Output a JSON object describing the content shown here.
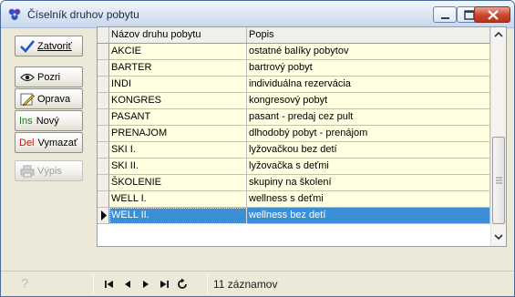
{
  "window": {
    "title": "Číselník druhov pobytu"
  },
  "buttons": {
    "close_label": "Zatvoriť",
    "view_label": "Pozri",
    "edit_label": "Oprava",
    "new_prefix": "Ins",
    "new_label": "Nový",
    "delete_prefix": "Del",
    "delete_label": "Vymazať",
    "print_label": "Výpis"
  },
  "table": {
    "columns": [
      "Názov druhu pobytu",
      "Popis"
    ],
    "rows": [
      {
        "name": "AKCIE",
        "desc": "ostatné balíky pobytov"
      },
      {
        "name": "BARTER",
        "desc": "bartrový pobyt"
      },
      {
        "name": "INDI",
        "desc": "individuálna rezervácia"
      },
      {
        "name": "KONGRES",
        "desc": "kongresový pobyt"
      },
      {
        "name": "PASANT",
        "desc": "pasant - predaj cez pult"
      },
      {
        "name": "PRENAJOM",
        "desc": "dlhodobý pobyt - prenájom"
      },
      {
        "name": "SKI I.",
        "desc": "lyžovačkou bez detí"
      },
      {
        "name": "SKI II.",
        "desc": "lyžovačka s deťmi"
      },
      {
        "name": "ŠKOLENIE",
        "desc": "skupiny na školení"
      },
      {
        "name": "WELL I.",
        "desc": "wellness s deťmi"
      },
      {
        "name": "WELL II.",
        "desc": "wellness bez detí"
      }
    ],
    "selected_index": 10
  },
  "status": {
    "record_count": "11 záznamov"
  },
  "colors": {
    "row_background": "#ffffe1",
    "selected_row": "#3c8fd6",
    "close_button": "#cc4a33"
  },
  "icons": {
    "app": "app-logo-icon",
    "close": "checkmark-icon",
    "view": "eye-icon",
    "edit": "pencil-icon",
    "print": "printer-icon",
    "help": "question-icon"
  }
}
